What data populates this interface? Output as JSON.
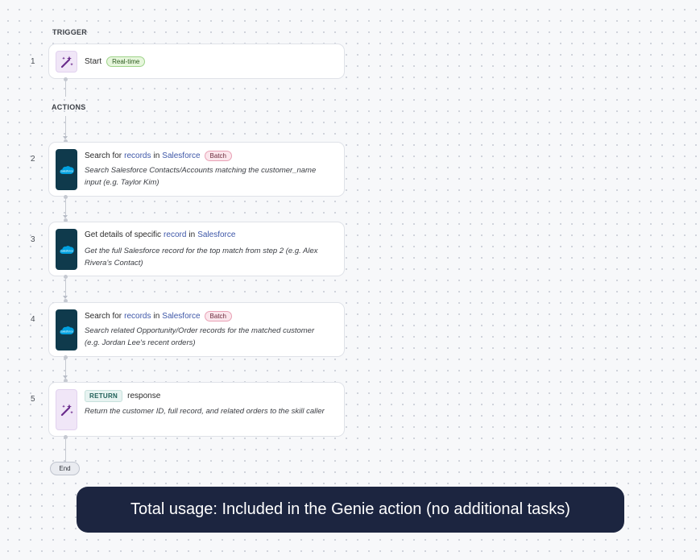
{
  "trigger": {
    "section_label": "TRIGGER",
    "step": {
      "number": "1",
      "icon": "magic-wand-icon",
      "title": "Start",
      "badge": "Real-time"
    }
  },
  "actions": {
    "section_label": "ACTIONS",
    "steps": [
      {
        "number": "2",
        "icon": "salesforce-icon",
        "title_prefix": "Search for",
        "title_object": "records",
        "title_mid": "in",
        "title_app": "Salesforce",
        "badge": "Batch",
        "description": "Search Salesforce Contacts/Accounts matching the customer_name input (e.g. Taylor Kim)"
      },
      {
        "number": "3",
        "icon": "salesforce-icon",
        "title_prefix": "Get details of specific",
        "title_object": "record",
        "title_mid": "in",
        "title_app": "Salesforce",
        "description": "Get the full Salesforce record for the top match from step 2 (e.g. Alex Rivera's Contact)"
      },
      {
        "number": "4",
        "icon": "salesforce-icon",
        "title_prefix": "Search for",
        "title_object": "records",
        "title_mid": "in",
        "title_app": "Salesforce",
        "badge": "Batch",
        "description": "Search related Opportunity/Order records for the matched customer (e.g. Jordan Lee's recent orders)"
      },
      {
        "number": "5",
        "icon": "magic-wand-icon",
        "keyword": "RETURN",
        "title": "response",
        "description": "Return the customer ID, full record, and related orders to the skill caller"
      }
    ]
  },
  "end_label": "End",
  "icon_text": {
    "salesforce": "salesforce"
  },
  "usage_banner": "Total usage: Included in the Genie action (no additional tasks)",
  "colors": {
    "salesforce_tile": "#0f3a4c",
    "salesforce_cloud": "#00a1e0",
    "magic_tile": "#f0e6f7",
    "magic_wand": "#6a2b8c",
    "link_blue": "#3e57a8",
    "banner_bg": "#1c2540"
  }
}
